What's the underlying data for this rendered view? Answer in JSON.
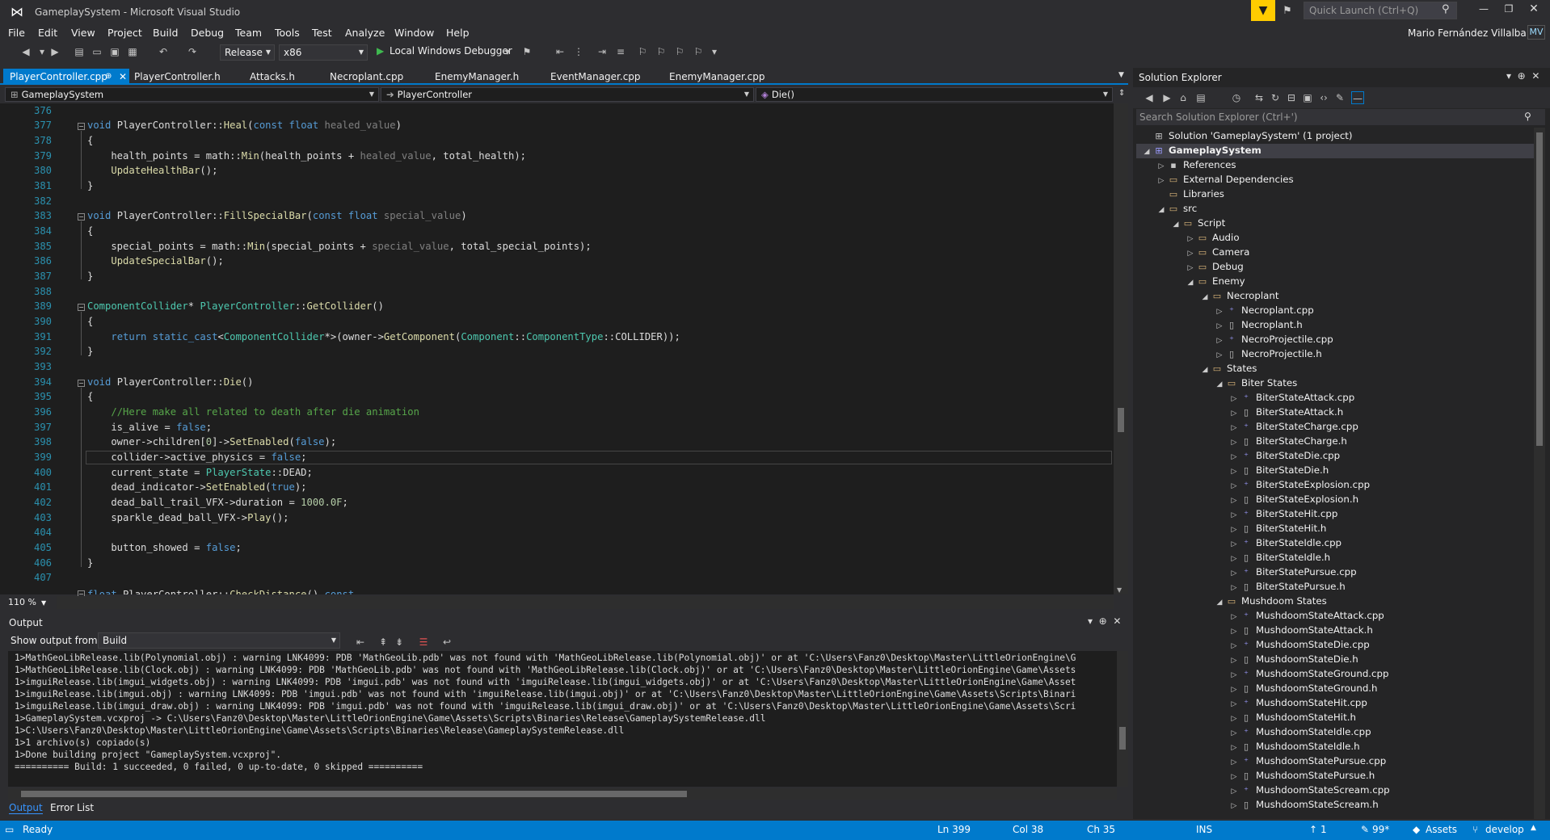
{
  "window": {
    "title": "GameplaySystem - Microsoft Visual Studio",
    "user": "Mario Fernández Villalba",
    "avatar": "MV",
    "quick_launch_placeholder": "Quick Launch (Ctrl+Q)"
  },
  "menu": [
    "File",
    "Edit",
    "View",
    "Project",
    "Build",
    "Debug",
    "Team",
    "Tools",
    "Test",
    "Analyze",
    "Window",
    "Help"
  ],
  "toolbar": {
    "configuration": "Release",
    "platform": "x86",
    "debugger": "Local Windows Debugger"
  },
  "tabs": [
    "PlayerController.cpp",
    "PlayerController.h",
    "Attacks.h",
    "Necroplant.cpp",
    "EnemyManager.h",
    "EventManager.cpp",
    "EnemyManager.cpp"
  ],
  "nav": {
    "project": "GameplaySystem",
    "class": "PlayerController",
    "member": "Die()"
  },
  "editor": {
    "zoom": "110 %"
  },
  "output": {
    "title": "Output",
    "show_from_label": "Show output from:",
    "source": "Build",
    "lines": [
      "1>MathGeoLibRelease.lib(Polynomial.obj) : warning LNK4099: PDB 'MathGeoLib.pdb' was not found with 'MathGeoLibRelease.lib(Polynomial.obj)' or at 'C:\\Users\\Fanz0\\Desktop\\Master\\LittleOrionEngine\\G",
      "1>MathGeoLibRelease.lib(Clock.obj) : warning LNK4099: PDB 'MathGeoLib.pdb' was not found with 'MathGeoLibRelease.lib(Clock.obj)' or at 'C:\\Users\\Fanz0\\Desktop\\Master\\LittleOrionEngine\\Game\\Assets",
      "1>imguiRelease.lib(imgui_widgets.obj) : warning LNK4099: PDB 'imgui.pdb' was not found with 'imguiRelease.lib(imgui_widgets.obj)' or at 'C:\\Users\\Fanz0\\Desktop\\Master\\LittleOrionEngine\\Game\\Asset",
      "1>imguiRelease.lib(imgui.obj) : warning LNK4099: PDB 'imgui.pdb' was not found with 'imguiRelease.lib(imgui.obj)' or at 'C:\\Users\\Fanz0\\Desktop\\Master\\LittleOrionEngine\\Game\\Assets\\Scripts\\Binari",
      "1>imguiRelease.lib(imgui_draw.obj) : warning LNK4099: PDB 'imgui.pdb' was not found with 'imguiRelease.lib(imgui_draw.obj)' or at 'C:\\Users\\Fanz0\\Desktop\\Master\\LittleOrionEngine\\Game\\Assets\\Scri",
      "1>GameplaySystem.vcxproj -> C:\\Users\\Fanz0\\Desktop\\Master\\LittleOrionEngine\\Game\\Assets\\Scripts\\Binaries\\Release\\GameplaySystemRelease.dll",
      "1>C:\\Users\\Fanz0\\Desktop\\Master\\LittleOrionEngine\\Game\\Assets\\Scripts\\Binaries\\Release\\GameplaySystemRelease.dll",
      "1>1 archivo(s) copiado(s)",
      "1>Done building project \"GameplaySystem.vcxproj\".",
      "========== Build: 1 succeeded, 0 failed, 0 up-to-date, 0 skipped =========="
    ]
  },
  "bottom_tabs": [
    "Output",
    "Error List"
  ],
  "solution_explorer": {
    "title": "Solution Explorer",
    "search_placeholder": "Search Solution Explorer (Ctrl+')",
    "items": [
      {
        "label": "Solution 'GameplaySystem' (1 project)",
        "depth": 0,
        "exp": "",
        "kind": "solution"
      },
      {
        "label": "GameplaySystem",
        "depth": 0,
        "exp": "◢",
        "kind": "project"
      },
      {
        "label": "References",
        "depth": 1,
        "exp": "▷",
        "kind": "ref"
      },
      {
        "label": "External Dependencies",
        "depth": 1,
        "exp": "▷",
        "kind": "folder"
      },
      {
        "label": "Libraries",
        "depth": 1,
        "exp": "",
        "kind": "folder"
      },
      {
        "label": "src",
        "depth": 1,
        "exp": "◢",
        "kind": "folder"
      },
      {
        "label": "Script",
        "depth": 2,
        "exp": "◢",
        "kind": "folder"
      },
      {
        "label": "Audio",
        "depth": 3,
        "exp": "▷",
        "kind": "folder"
      },
      {
        "label": "Camera",
        "depth": 3,
        "exp": "▷",
        "kind": "folder"
      },
      {
        "label": "Debug",
        "depth": 3,
        "exp": "▷",
        "kind": "folder"
      },
      {
        "label": "Enemy",
        "depth": 3,
        "exp": "◢",
        "kind": "folder"
      },
      {
        "label": "Necroplant",
        "depth": 4,
        "exp": "◢",
        "kind": "folder"
      },
      {
        "label": "Necroplant.cpp",
        "depth": 5,
        "exp": "▷",
        "kind": "cpp"
      },
      {
        "label": "Necroplant.h",
        "depth": 5,
        "exp": "▷",
        "kind": "h"
      },
      {
        "label": "NecroProjectile.cpp",
        "depth": 5,
        "exp": "▷",
        "kind": "cpp"
      },
      {
        "label": "NecroProjectile.h",
        "depth": 5,
        "exp": "▷",
        "kind": "h"
      },
      {
        "label": "States",
        "depth": 4,
        "exp": "◢",
        "kind": "folder"
      },
      {
        "label": "Biter States",
        "depth": 5,
        "exp": "◢",
        "kind": "folder"
      },
      {
        "label": "BiterStateAttack.cpp",
        "depth": 6,
        "exp": "▷",
        "kind": "cpp"
      },
      {
        "label": "BiterStateAttack.h",
        "depth": 6,
        "exp": "▷",
        "kind": "h"
      },
      {
        "label": "BiterStateCharge.cpp",
        "depth": 6,
        "exp": "▷",
        "kind": "cpp"
      },
      {
        "label": "BiterStateCharge.h",
        "depth": 6,
        "exp": "▷",
        "kind": "h"
      },
      {
        "label": "BiterStateDie.cpp",
        "depth": 6,
        "exp": "▷",
        "kind": "cpp"
      },
      {
        "label": "BiterStateDie.h",
        "depth": 6,
        "exp": "▷",
        "kind": "h"
      },
      {
        "label": "BiterStateExplosion.cpp",
        "depth": 6,
        "exp": "▷",
        "kind": "cpp"
      },
      {
        "label": "BiterStateExplosion.h",
        "depth": 6,
        "exp": "▷",
        "kind": "h"
      },
      {
        "label": "BiterStateHit.cpp",
        "depth": 6,
        "exp": "▷",
        "kind": "cpp"
      },
      {
        "label": "BiterStateHit.h",
        "depth": 6,
        "exp": "▷",
        "kind": "h"
      },
      {
        "label": "BiterStateIdle.cpp",
        "depth": 6,
        "exp": "▷",
        "kind": "cpp"
      },
      {
        "label": "BiterStateIdle.h",
        "depth": 6,
        "exp": "▷",
        "kind": "h"
      },
      {
        "label": "BiterStatePursue.cpp",
        "depth": 6,
        "exp": "▷",
        "kind": "cpp"
      },
      {
        "label": "BiterStatePursue.h",
        "depth": 6,
        "exp": "▷",
        "kind": "h"
      },
      {
        "label": "Mushdoom States",
        "depth": 5,
        "exp": "◢",
        "kind": "folder"
      },
      {
        "label": "MushdoomStateAttack.cpp",
        "depth": 6,
        "exp": "▷",
        "kind": "cpp"
      },
      {
        "label": "MushdoomStateAttack.h",
        "depth": 6,
        "exp": "▷",
        "kind": "h"
      },
      {
        "label": "MushdoomStateDie.cpp",
        "depth": 6,
        "exp": "▷",
        "kind": "cpp"
      },
      {
        "label": "MushdoomStateDie.h",
        "depth": 6,
        "exp": "▷",
        "kind": "h"
      },
      {
        "label": "MushdoomStateGround.cpp",
        "depth": 6,
        "exp": "▷",
        "kind": "cpp"
      },
      {
        "label": "MushdoomStateGround.h",
        "depth": 6,
        "exp": "▷",
        "kind": "h"
      },
      {
        "label": "MushdoomStateHit.cpp",
        "depth": 6,
        "exp": "▷",
        "kind": "cpp"
      },
      {
        "label": "MushdoomStateHit.h",
        "depth": 6,
        "exp": "▷",
        "kind": "h"
      },
      {
        "label": "MushdoomStateIdle.cpp",
        "depth": 6,
        "exp": "▷",
        "kind": "cpp"
      },
      {
        "label": "MushdoomStateIdle.h",
        "depth": 6,
        "exp": "▷",
        "kind": "h"
      },
      {
        "label": "MushdoomStatePursue.cpp",
        "depth": 6,
        "exp": "▷",
        "kind": "cpp"
      },
      {
        "label": "MushdoomStatePursue.h",
        "depth": 6,
        "exp": "▷",
        "kind": "h"
      },
      {
        "label": "MushdoomStateScream.cpp",
        "depth": 6,
        "exp": "▷",
        "kind": "cpp"
      },
      {
        "label": "MushdoomStateScream.h",
        "depth": 6,
        "exp": "▷",
        "kind": "h"
      }
    ]
  },
  "status": {
    "ready": "Ready",
    "line": "Ln 399",
    "col": "Col 38",
    "ch": "Ch 35",
    "mode": "INS",
    "changes": "1",
    "edits": "99*",
    "repo": "Assets",
    "branch": "develop"
  },
  "colors": {
    "accent": "#007acc",
    "bg": "#1e1e1e",
    "chrome": "#2d2d30",
    "keyword": "#569cd6",
    "type": "#4ec9b0",
    "comment": "#57a64a",
    "param": "#808080"
  }
}
